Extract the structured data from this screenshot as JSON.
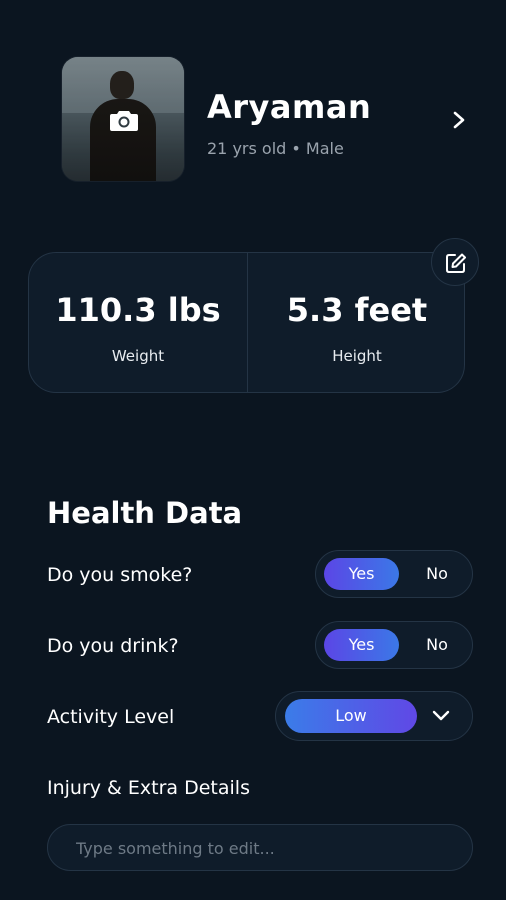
{
  "profile": {
    "name": "Aryaman",
    "details": "21 yrs old • Male"
  },
  "stats": {
    "weight_value": "110.3 lbs",
    "weight_label": "Weight",
    "height_value": "5.3 feet",
    "height_label": "Height"
  },
  "health": {
    "title": "Health Data",
    "smoke_question": "Do you smoke?",
    "drink_question": "Do you drink?",
    "activity_label": "Activity Level",
    "injury_label": "Injury & Extra Details",
    "yes_label": "Yes",
    "no_label": "No",
    "smoke_selected": "Yes",
    "drink_selected": "Yes",
    "activity_value": "Low",
    "injury_placeholder": "Type something to edit..."
  },
  "icons": {
    "camera": "camera-icon",
    "chevron_right": "chevron-right-icon",
    "edit": "edit-icon",
    "chevron_down": "chevron-down-icon"
  },
  "colors": {
    "background": "#0b1520",
    "card": "#0f1c2a",
    "border": "#243445",
    "accent_purple": "#5b46e6",
    "accent_blue": "#3b78e7"
  }
}
